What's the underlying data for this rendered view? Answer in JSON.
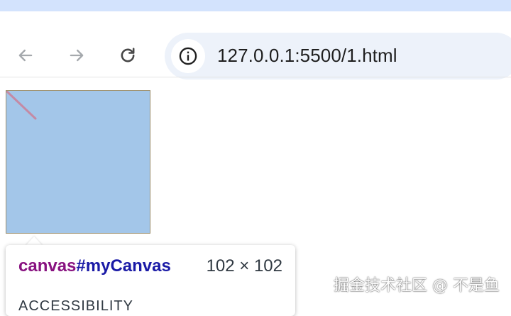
{
  "browser": {
    "address_bar": {
      "url": "127.0.0.1:5500/1.html"
    },
    "icons": {
      "back": "back-arrow-icon",
      "forward": "forward-arrow-icon",
      "reload": "reload-icon",
      "site_info": "info-icon"
    },
    "colors": {
      "frame": "#d3e3fd",
      "omnibox": "#edf2fa"
    }
  },
  "page": {
    "canvas": {
      "id": "myCanvas",
      "fill": "#a3c6e9",
      "stroke_color": "#c48aa4"
    }
  },
  "inspect_tooltip": {
    "tag": "canvas",
    "id_selector": "#myCanvas",
    "size": "102 × 102",
    "section": "ACCESSIBILITY",
    "colors": {
      "tag": "#881280",
      "id": "#1a1aa6"
    }
  },
  "watermark": {
    "text": "掘金技术社区 @ 不是鱼"
  }
}
